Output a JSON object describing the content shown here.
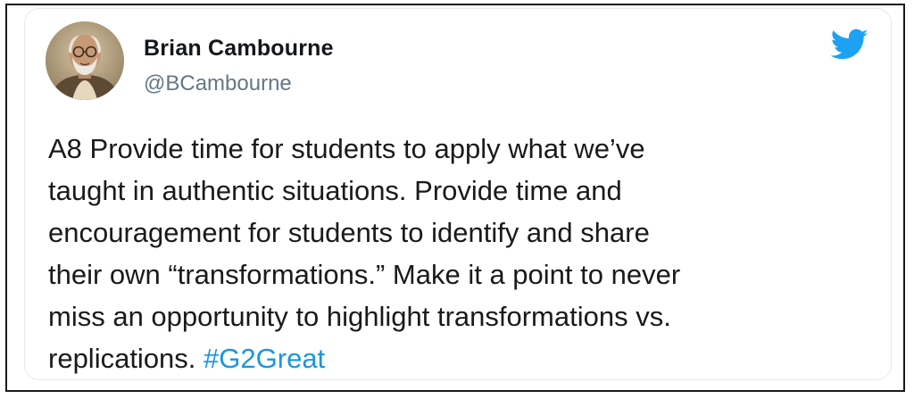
{
  "tweet": {
    "author": {
      "display_name": "Brian Cambourne",
      "handle": "@BCambourne",
      "avatar_icon": "avatar-photo"
    },
    "logo_icon": "twitter-bird-icon",
    "brand_color": "#1da1f2",
    "hashtag_color": "#1b95e0",
    "text_lines": [
      "A8 Provide time for students to apply what we’ve",
      "taught in authentic situations. Provide time and",
      "encouragement for students to identify and share",
      "their own “transformations.” Make it a point to never",
      "miss an opportunity to highlight transformations vs.",
      "replications."
    ],
    "hashtag": "#G2Great"
  }
}
